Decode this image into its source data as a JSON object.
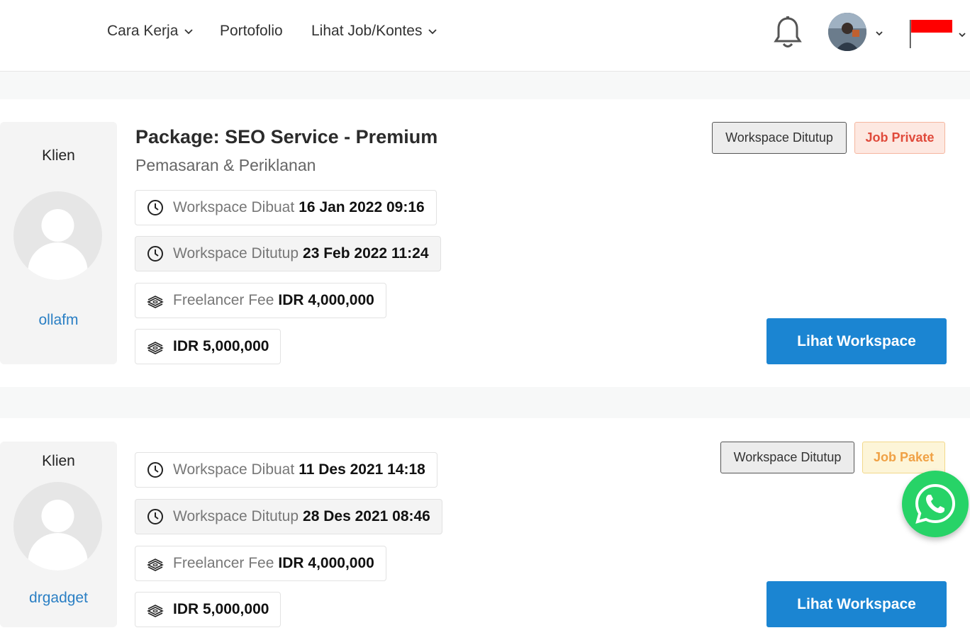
{
  "nav": {
    "items": [
      {
        "label": "Cara Kerja",
        "has_dropdown": true
      },
      {
        "label": "Portofolio",
        "has_dropdown": false
      },
      {
        "label": "Lihat Job/Kontes",
        "has_dropdown": true
      }
    ],
    "icons": {
      "notifications": "bell-icon",
      "language": "indonesia-flag-icon"
    }
  },
  "cards": [
    {
      "client_label": "Klien",
      "client_name": "ollafm",
      "title": "Package: SEO Service - Premium",
      "subtitle": "Pemasaran & Periklanan",
      "created_label": "Workspace Dibuat",
      "created_value": "16 Jan 2022 09:16",
      "closed_label": "Workspace Ditutup",
      "closed_value": "23 Feb 2022 11:24",
      "fee_label": "Freelancer Fee",
      "fee_value": "IDR 4,000,000",
      "price_value": "IDR 5,000,000",
      "status_tag": "Workspace Ditutup",
      "type_tag": "Job Private",
      "action_label": "Lihat Workspace"
    },
    {
      "client_label": "Klien",
      "client_name": "drgadget",
      "created_label": "Workspace Dibuat",
      "created_value": "11 Des 2021 14:18",
      "closed_label": "Workspace Ditutup",
      "closed_value": "28 Des 2021 08:46",
      "fee_label": "Freelancer Fee",
      "fee_value": "IDR 4,000,000",
      "price_value": "IDR 5,000,000",
      "status_tag": "Workspace Ditutup",
      "type_tag": "Job Paket",
      "action_label": "Lihat Workspace"
    }
  ],
  "colors": {
    "primary": "#1b85d2",
    "link": "#2a7fc4",
    "private_tag": "#e04a3b",
    "paket_tag": "#f0a145",
    "whatsapp": "#27d367"
  }
}
